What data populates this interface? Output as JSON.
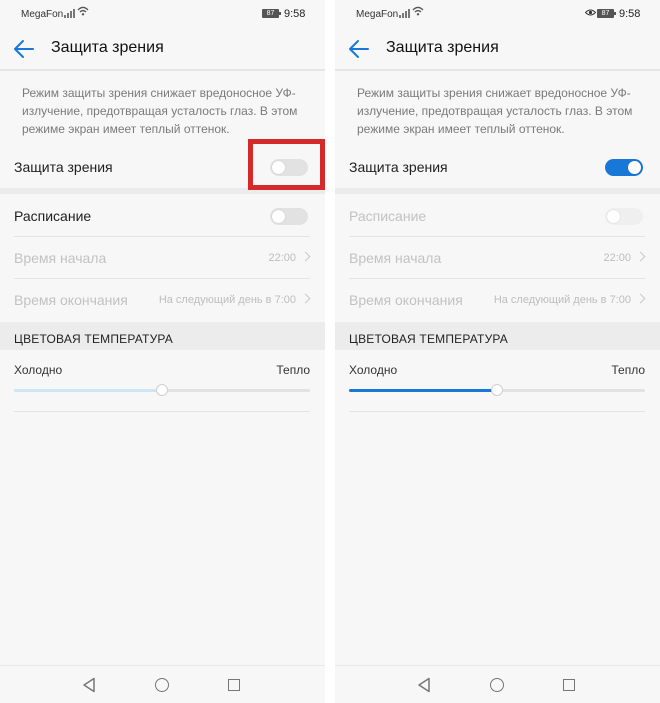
{
  "colors": {
    "accent": "#1877d7",
    "highlight": "#d52a2a",
    "disabled_text": "#c2c2c2",
    "description_text": "#7a7a7a"
  },
  "screens": [
    {
      "status": {
        "carrier": "MegaFon",
        "battery": "87",
        "time": "9:58",
        "eye_comfort_icon": false
      },
      "header": {
        "title": "Защита зрения",
        "back_icon": "arrow-left-icon"
      },
      "description": "Режим защиты зрения снижает вредоносное УФ-излучение, предотвращая усталость глаз. В этом режиме экран имеет теплый оттенок.",
      "eye_comfort": {
        "label": "Защита зрения",
        "enabled": false,
        "highlighted": true
      },
      "schedule": {
        "label": "Расписание",
        "enabled": false,
        "disabled": false
      },
      "start_time": {
        "label": "Время начала",
        "value": "22:00"
      },
      "end_time": {
        "label": "Время окончания",
        "value": "На следующий день в 7:00"
      },
      "color_temperature": {
        "heading": "ЦВЕТОВАЯ ТЕМПЕРАТУРА",
        "cold": "Холодно",
        "warm": "Тепло",
        "level": 0.5,
        "active": false
      }
    },
    {
      "status": {
        "carrier": "MegaFon",
        "battery": "87",
        "time": "9:58",
        "eye_comfort_icon": true
      },
      "header": {
        "title": "Защита зрения",
        "back_icon": "arrow-left-icon"
      },
      "description": "Режим защиты зрения снижает вредоносное УФ-излучение, предотвращая усталость глаз. В этом режиме экран имеет теплый оттенок.",
      "eye_comfort": {
        "label": "Защита зрения",
        "enabled": true,
        "highlighted": false
      },
      "schedule": {
        "label": "Расписание",
        "enabled": false,
        "disabled": true
      },
      "start_time": {
        "label": "Время начала",
        "value": "22:00"
      },
      "end_time": {
        "label": "Время окончания",
        "value": "На следующий день в 7:00"
      },
      "color_temperature": {
        "heading": "ЦВЕТОВАЯ ТЕМПЕРАТУРА",
        "cold": "Холодно",
        "warm": "Тепло",
        "level": 0.5,
        "active": true
      }
    }
  ],
  "navbar": {
    "back_icon": "triangle-back-icon",
    "home_icon": "circle-home-icon",
    "recent_icon": "square-recents-icon"
  }
}
